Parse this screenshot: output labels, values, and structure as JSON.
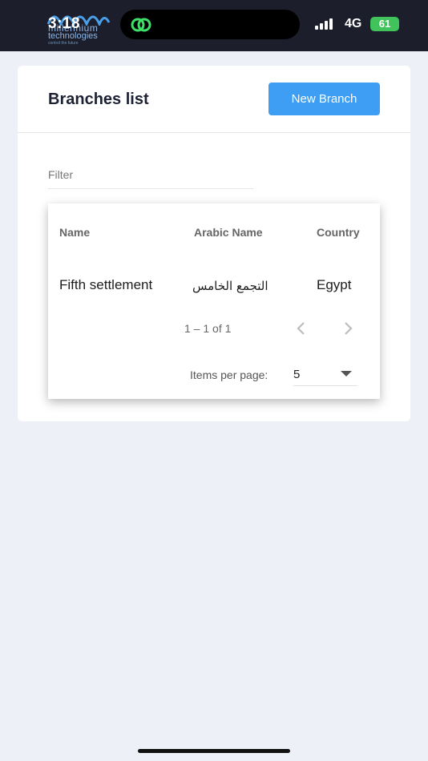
{
  "status_bar": {
    "time": "3:18",
    "network": "4G",
    "battery": "61",
    "logo": {
      "line1": "millennium",
      "line2": "technologies",
      "tagline": "control the future"
    }
  },
  "header": {
    "title": "Branches list",
    "new_branch_label": "New Branch"
  },
  "filter": {
    "placeholder": "Filter",
    "value": ""
  },
  "table": {
    "columns": [
      "Name",
      "Arabic Name",
      "Country"
    ],
    "rows": [
      {
        "name": "Fifth settlement",
        "arabic_name": "التجمع الخامس",
        "country": "Egypt"
      }
    ]
  },
  "paginator": {
    "range_label": "1 – 1 of 1",
    "items_per_page_label": "Items per page:",
    "page_size": "5"
  },
  "colors": {
    "accent": "#3d9ef4",
    "status_bar_bg": "#1c1f2b",
    "page_bg": "#eef0f7",
    "battery": "#3fc35a"
  },
  "icons": [
    "app-logo-icon",
    "link-icon",
    "signal-icon",
    "chevron-left-icon",
    "chevron-right-icon",
    "dropdown-arrow-icon"
  ]
}
